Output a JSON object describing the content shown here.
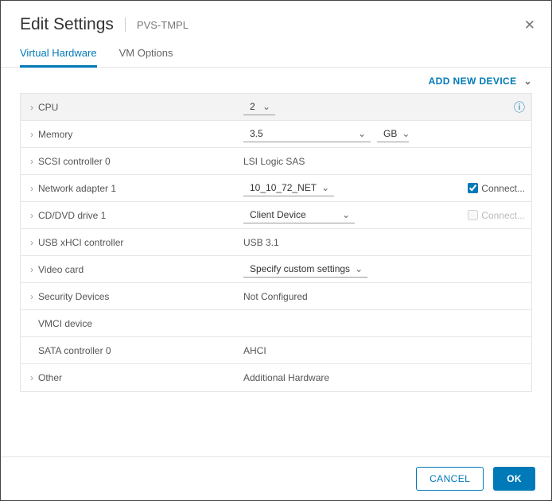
{
  "header": {
    "title": "Edit Settings",
    "subtitle": "PVS-TMPL"
  },
  "tabs": {
    "active": "Virtual Hardware",
    "other": "VM Options"
  },
  "actions": {
    "addDevice": "ADD NEW DEVICE"
  },
  "rows": {
    "cpu": {
      "label": "CPU",
      "value": "2"
    },
    "memory": {
      "label": "Memory",
      "value": "3.5",
      "unit": "GB"
    },
    "scsi": {
      "label": "SCSI controller 0",
      "value": "LSI Logic SAS"
    },
    "net": {
      "label": "Network adapter 1",
      "value": "10_10_72_NET",
      "connect": "Connect..."
    },
    "cd": {
      "label": "CD/DVD drive 1",
      "value": "Client Device",
      "connect": "Connect..."
    },
    "usb": {
      "label": "USB xHCI controller",
      "value": "USB 3.1"
    },
    "video": {
      "label": "Video card",
      "value": "Specify custom settings"
    },
    "security": {
      "label": "Security Devices",
      "value": "Not Configured"
    },
    "vmci": {
      "label": "VMCI device"
    },
    "sata": {
      "label": "SATA controller 0",
      "value": "AHCI"
    },
    "other": {
      "label": "Other",
      "value": "Additional Hardware"
    }
  },
  "footer": {
    "cancel": "CANCEL",
    "ok": "OK"
  }
}
